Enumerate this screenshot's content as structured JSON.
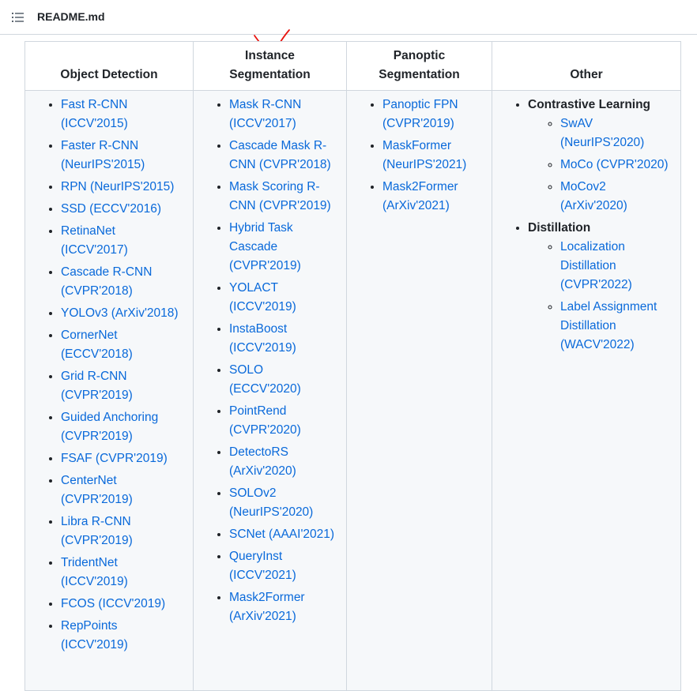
{
  "header": {
    "toc_icon": "list-unordered-icon",
    "file_name": "README.md"
  },
  "annotation": {
    "icon": "red-checkmark",
    "color": "#e8130e"
  },
  "colors": {
    "link": "#0969da",
    "cell_bg": "#f6f8fa",
    "border": "#d0d7de"
  },
  "table": {
    "columns": [
      "Object Detection",
      "Instance Segmentation",
      "Panoptic Segmentation",
      "Other"
    ],
    "object_detection": [
      "Fast R-CNN (ICCV'2015)",
      "Faster R-CNN (NeurIPS'2015)",
      "RPN (NeurIPS'2015)",
      "SSD (ECCV'2016)",
      "RetinaNet (ICCV'2017)",
      "Cascade R-CNN (CVPR'2018)",
      "YOLOv3 (ArXiv'2018)",
      "CornerNet (ECCV'2018)",
      "Grid R-CNN (CVPR'2019)",
      "Guided Anchoring (CVPR'2019)",
      "FSAF (CVPR'2019)",
      "CenterNet (CVPR'2019)",
      "Libra R-CNN (CVPR'2019)",
      "TridentNet (ICCV'2019)",
      "FCOS (ICCV'2019)",
      "RepPoints (ICCV'2019)"
    ],
    "instance_segmentation": [
      "Mask R-CNN (ICCV'2017)",
      "Cascade Mask R-CNN (CVPR'2018)",
      "Mask Scoring R-CNN (CVPR'2019)",
      "Hybrid Task Cascade (CVPR'2019)",
      "YOLACT (ICCV'2019)",
      "InstaBoost (ICCV'2019)",
      "SOLO (ECCV'2020)",
      "PointRend (CVPR'2020)",
      "DetectoRS (ArXiv'2020)",
      "SOLOv2 (NeurIPS'2020)",
      "SCNet (AAAI'2021)",
      "QueryInst (ICCV'2021)",
      "Mask2Former (ArXiv'2021)"
    ],
    "panoptic_segmentation": [
      "Panoptic FPN (CVPR'2019)",
      "MaskFormer (NeurIPS'2021)",
      "Mask2Former (ArXiv'2021)"
    ],
    "other": {
      "groups": [
        {
          "label": "Contrastive Learning",
          "items": [
            "SwAV (NeurIPS'2020)",
            "MoCo (CVPR'2020)",
            "MoCov2 (ArXiv'2020)"
          ]
        },
        {
          "label": "Distillation",
          "items": [
            "Localization Distillation (CVPR'2022)",
            "Label Assignment Distillation (WACV'2022)"
          ]
        }
      ]
    }
  }
}
